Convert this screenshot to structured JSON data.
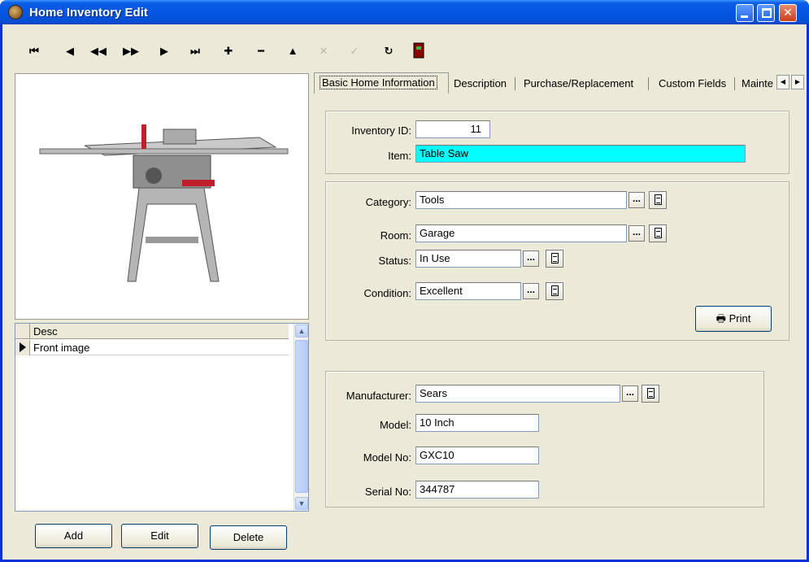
{
  "window": {
    "title": "Home Inventory Edit"
  },
  "toolbar": {
    "buttons": [
      {
        "name": "first-record-icon",
        "glyph": "⏮"
      },
      {
        "name": "prior-record-icon",
        "glyph": "◀"
      },
      {
        "name": "prior-page-icon",
        "glyph": "◀◀"
      },
      {
        "name": "next-page-icon",
        "glyph": "▶▶"
      },
      {
        "name": "next-record-icon",
        "glyph": "▶"
      },
      {
        "name": "last-record-icon",
        "glyph": "⏭"
      },
      {
        "name": "insert-icon",
        "glyph": "✚"
      },
      {
        "name": "delete-icon",
        "glyph": "━"
      },
      {
        "name": "edit-icon",
        "glyph": "▲"
      },
      {
        "name": "cancel-icon",
        "glyph": "✕"
      },
      {
        "name": "post-icon",
        "glyph": "✓"
      },
      {
        "name": "refresh-icon",
        "glyph": "↻"
      },
      {
        "name": "exit-door-icon",
        "glyph": "▮"
      }
    ]
  },
  "images_grid": {
    "column_header": "Desc",
    "rows": [
      {
        "desc": "Front image"
      }
    ]
  },
  "left_buttons": {
    "add": "Add",
    "edit": "Edit",
    "delete": "Delete"
  },
  "tabs": [
    "Basic Home Information",
    "Description",
    "Purchase/Replacement",
    "Custom Fields",
    "Mainte"
  ],
  "form": {
    "inventory_id": {
      "label": "Inventory ID:",
      "value": "11"
    },
    "item": {
      "label": "Item:",
      "value": "Table Saw"
    },
    "category": {
      "label": "Category:",
      "value": "Tools"
    },
    "room": {
      "label": "Room:",
      "value": "Garage"
    },
    "status": {
      "label": "Status:",
      "value": "In Use"
    },
    "condition": {
      "label": "Condition:",
      "value": "Excellent"
    },
    "print_button": "Print",
    "manufacturer": {
      "label": "Manufacturer:",
      "value": "Sears"
    },
    "model": {
      "label": "Model:",
      "value": "10 Inch"
    },
    "model_no": {
      "label": "Model No:",
      "value": "GXC10"
    },
    "serial_no": {
      "label": "Serial No:",
      "value": "344787"
    },
    "ellipsis": "..."
  },
  "colors": {
    "item_field": "#00ffff",
    "titlebar": "#0554e3"
  }
}
